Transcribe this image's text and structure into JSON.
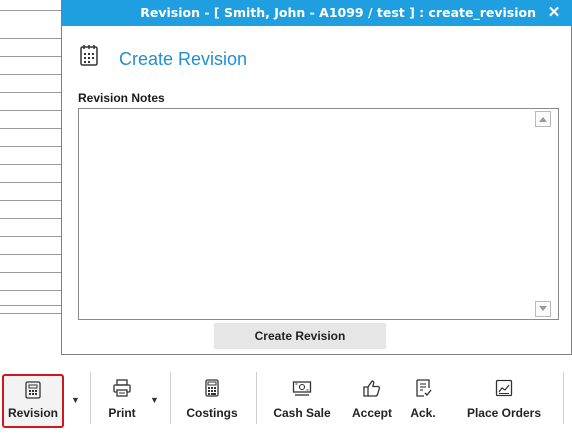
{
  "dialog": {
    "title": "Revision - [ Smith, John - A1099 / test ] : create_revision",
    "close_symbol": "✕",
    "icon": "revision-document-icon",
    "heading": "Create Revision",
    "notes_label": "Revision Notes",
    "notes_value": "",
    "create_button_label": "Create Revision",
    "accent_color": "#1f9ee0"
  },
  "toolbar": {
    "items": [
      {
        "label": "Revision",
        "icon": "revision-icon",
        "selected": true,
        "has_dropdown": true
      },
      {
        "label": "Print",
        "icon": "printer-icon",
        "selected": false,
        "has_dropdown": true
      },
      {
        "label": "Costings",
        "icon": "calculator-icon",
        "selected": false,
        "has_dropdown": false
      },
      {
        "label": "Cash Sale",
        "icon": "cash-icon",
        "selected": false,
        "has_dropdown": false
      },
      {
        "label": "Accept",
        "icon": "thumbs-up-icon",
        "selected": false,
        "has_dropdown": false
      },
      {
        "label": "Ack.",
        "icon": "checklist-icon",
        "selected": false,
        "has_dropdown": false
      },
      {
        "label": "Place Orders",
        "icon": "orders-icon",
        "selected": false,
        "has_dropdown": false
      }
    ],
    "dropdown_symbol": "▼",
    "highlight_color": "#d0181a"
  }
}
